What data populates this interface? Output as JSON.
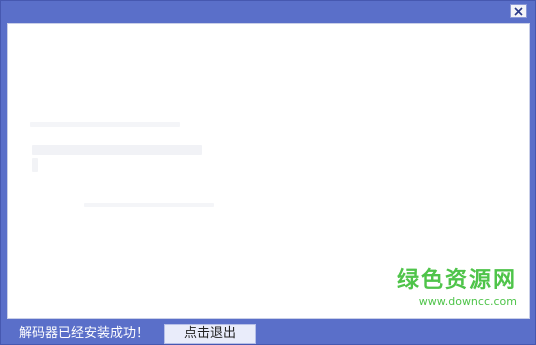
{
  "window": {
    "close_label": "✕"
  },
  "status": {
    "message": "解码器已经安装成功！"
  },
  "actions": {
    "exit_label": "点击退出"
  },
  "watermark": {
    "brand": "绿色资源网",
    "url": "www.downcc.com"
  },
  "colors": {
    "frame": "#5a6fc9",
    "panel": "#ffffff",
    "watermark": "#4fc44a"
  }
}
